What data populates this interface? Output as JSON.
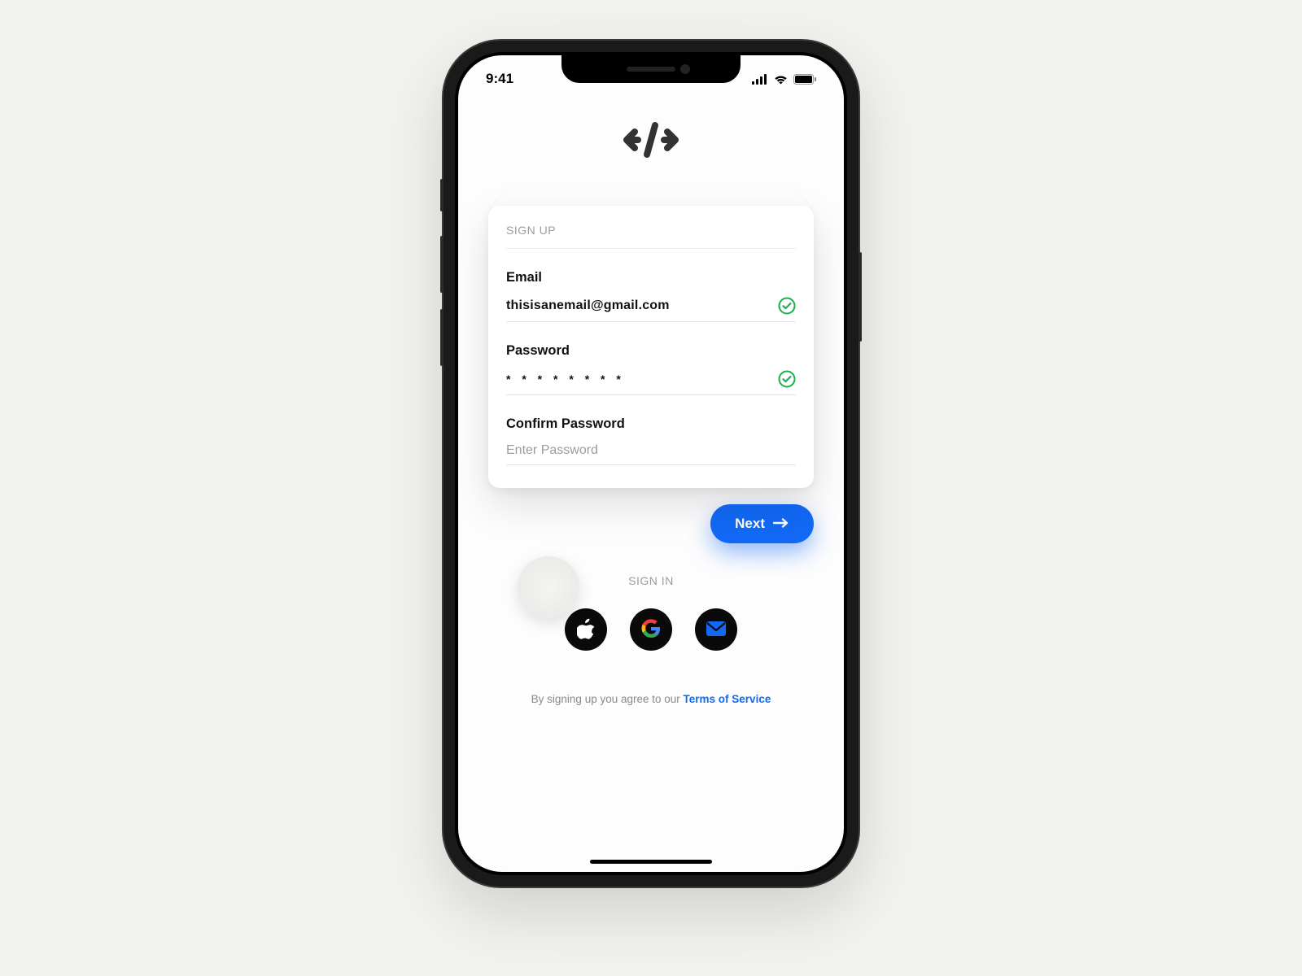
{
  "statusbar": {
    "time": "9:41"
  },
  "card": {
    "title": "SIGN UP",
    "email_label": "Email",
    "email_value": "thisisanemail@gmail.com",
    "email_valid": true,
    "password_label": "Password",
    "password_value": "* * * * * * * *",
    "password_valid": true,
    "confirm_label": "Confirm Password",
    "confirm_placeholder": "Enter Password",
    "confirm_value": ""
  },
  "next_button": {
    "label": "Next"
  },
  "signin": {
    "label": "SIGN IN"
  },
  "footer": {
    "prefix": "By signing up you agree to our ",
    "link": "Terms of Service"
  },
  "colors": {
    "accent": "#1169f5",
    "valid": "#17b04a"
  }
}
